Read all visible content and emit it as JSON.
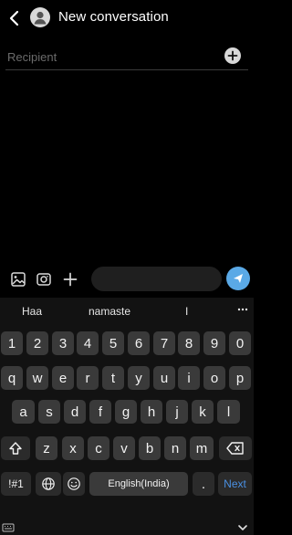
{
  "header": {
    "title": "New conversation"
  },
  "recipient": {
    "placeholder": "Recipient"
  },
  "keyboard": {
    "suggestions": [
      "Haa",
      "namaste",
      "I"
    ],
    "rows": {
      "numbers": [
        "1",
        "2",
        "3",
        "4",
        "5",
        "6",
        "7",
        "8",
        "9",
        "0"
      ],
      "row1": [
        "q",
        "w",
        "e",
        "r",
        "t",
        "y",
        "u",
        "i",
        "o",
        "p"
      ],
      "row2": [
        "a",
        "s",
        "d",
        "f",
        "g",
        "h",
        "j",
        "k",
        "l"
      ],
      "row3": [
        "z",
        "x",
        "c",
        "v",
        "b",
        "n",
        "m"
      ]
    },
    "symbols_label": "!#1",
    "space_label": "English(India)",
    "period_label": ".",
    "next_label": "Next"
  },
  "colors": {
    "background": "#000000",
    "keyboard_bg": "#121212",
    "key_bg": "#3a3a3a",
    "accent": "#5aa9e6",
    "next_text": "#4a90e2"
  },
  "icons": {
    "back": "chevron-left-icon",
    "avatar": "person-icon",
    "recipient_add": "plus-icon",
    "gallery": "image-icon",
    "camera": "camera-icon",
    "attach": "plus-icon",
    "send": "send-icon",
    "shift": "shift-icon",
    "backspace": "backspace-icon",
    "globe": "globe-icon",
    "emoji": "emoji-icon",
    "more": "more-dots-icon",
    "hide_keyboard": "keyboard-icon",
    "collapse": "chevron-down-icon"
  }
}
